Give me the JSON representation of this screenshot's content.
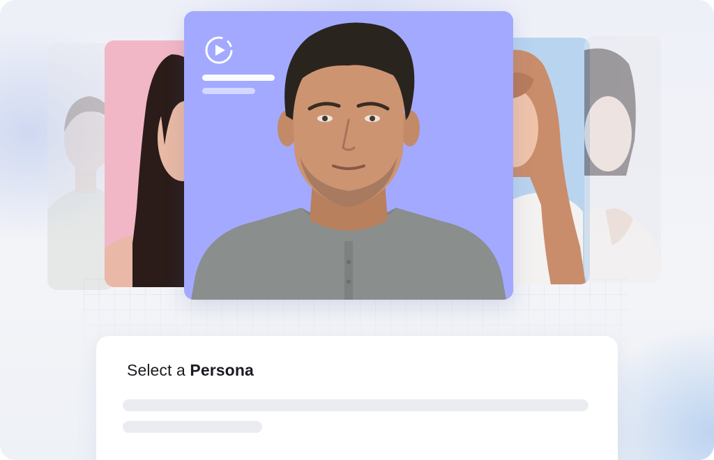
{
  "persona_panel": {
    "title_prefix": "Select a",
    "title_emphasis": "Persona"
  },
  "video_card": {
    "icon": "play-circle-icon"
  },
  "personas": [
    {
      "position": "far-left",
      "accent": "#e7e9ee"
    },
    {
      "position": "left",
      "accent": "#f2b6c6"
    },
    {
      "position": "center",
      "accent": "#a3a9ff"
    },
    {
      "position": "right",
      "accent": "#b9d4ef"
    },
    {
      "position": "far-right",
      "accent": "#e9eaee"
    }
  ]
}
